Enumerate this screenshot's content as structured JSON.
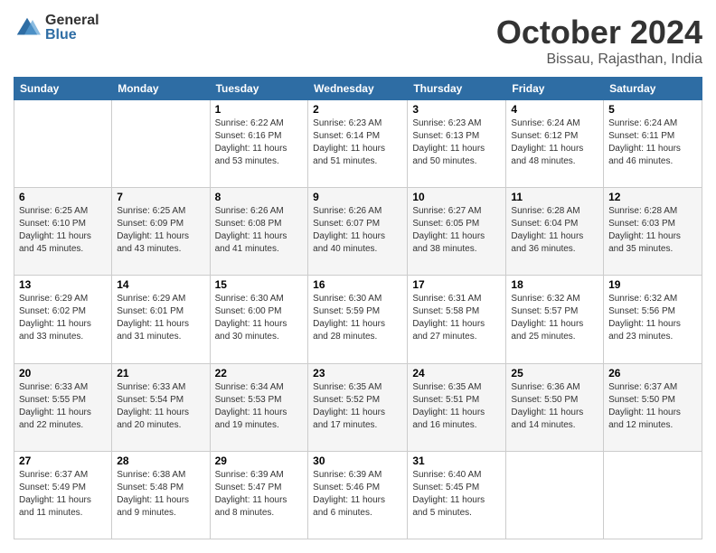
{
  "header": {
    "logo_general": "General",
    "logo_blue": "Blue",
    "title": "October 2024",
    "location": "Bissau, Rajasthan, India"
  },
  "weekdays": [
    "Sunday",
    "Monday",
    "Tuesday",
    "Wednesday",
    "Thursday",
    "Friday",
    "Saturday"
  ],
  "weeks": [
    [
      {
        "day": "",
        "info": ""
      },
      {
        "day": "",
        "info": ""
      },
      {
        "day": "1",
        "info": "Sunrise: 6:22 AM\nSunset: 6:16 PM\nDaylight: 11 hours and 53 minutes."
      },
      {
        "day": "2",
        "info": "Sunrise: 6:23 AM\nSunset: 6:14 PM\nDaylight: 11 hours and 51 minutes."
      },
      {
        "day": "3",
        "info": "Sunrise: 6:23 AM\nSunset: 6:13 PM\nDaylight: 11 hours and 50 minutes."
      },
      {
        "day": "4",
        "info": "Sunrise: 6:24 AM\nSunset: 6:12 PM\nDaylight: 11 hours and 48 minutes."
      },
      {
        "day": "5",
        "info": "Sunrise: 6:24 AM\nSunset: 6:11 PM\nDaylight: 11 hours and 46 minutes."
      }
    ],
    [
      {
        "day": "6",
        "info": "Sunrise: 6:25 AM\nSunset: 6:10 PM\nDaylight: 11 hours and 45 minutes."
      },
      {
        "day": "7",
        "info": "Sunrise: 6:25 AM\nSunset: 6:09 PM\nDaylight: 11 hours and 43 minutes."
      },
      {
        "day": "8",
        "info": "Sunrise: 6:26 AM\nSunset: 6:08 PM\nDaylight: 11 hours and 41 minutes."
      },
      {
        "day": "9",
        "info": "Sunrise: 6:26 AM\nSunset: 6:07 PM\nDaylight: 11 hours and 40 minutes."
      },
      {
        "day": "10",
        "info": "Sunrise: 6:27 AM\nSunset: 6:05 PM\nDaylight: 11 hours and 38 minutes."
      },
      {
        "day": "11",
        "info": "Sunrise: 6:28 AM\nSunset: 6:04 PM\nDaylight: 11 hours and 36 minutes."
      },
      {
        "day": "12",
        "info": "Sunrise: 6:28 AM\nSunset: 6:03 PM\nDaylight: 11 hours and 35 minutes."
      }
    ],
    [
      {
        "day": "13",
        "info": "Sunrise: 6:29 AM\nSunset: 6:02 PM\nDaylight: 11 hours and 33 minutes."
      },
      {
        "day": "14",
        "info": "Sunrise: 6:29 AM\nSunset: 6:01 PM\nDaylight: 11 hours and 31 minutes."
      },
      {
        "day": "15",
        "info": "Sunrise: 6:30 AM\nSunset: 6:00 PM\nDaylight: 11 hours and 30 minutes."
      },
      {
        "day": "16",
        "info": "Sunrise: 6:30 AM\nSunset: 5:59 PM\nDaylight: 11 hours and 28 minutes."
      },
      {
        "day": "17",
        "info": "Sunrise: 6:31 AM\nSunset: 5:58 PM\nDaylight: 11 hours and 27 minutes."
      },
      {
        "day": "18",
        "info": "Sunrise: 6:32 AM\nSunset: 5:57 PM\nDaylight: 11 hours and 25 minutes."
      },
      {
        "day": "19",
        "info": "Sunrise: 6:32 AM\nSunset: 5:56 PM\nDaylight: 11 hours and 23 minutes."
      }
    ],
    [
      {
        "day": "20",
        "info": "Sunrise: 6:33 AM\nSunset: 5:55 PM\nDaylight: 11 hours and 22 minutes."
      },
      {
        "day": "21",
        "info": "Sunrise: 6:33 AM\nSunset: 5:54 PM\nDaylight: 11 hours and 20 minutes."
      },
      {
        "day": "22",
        "info": "Sunrise: 6:34 AM\nSunset: 5:53 PM\nDaylight: 11 hours and 19 minutes."
      },
      {
        "day": "23",
        "info": "Sunrise: 6:35 AM\nSunset: 5:52 PM\nDaylight: 11 hours and 17 minutes."
      },
      {
        "day": "24",
        "info": "Sunrise: 6:35 AM\nSunset: 5:51 PM\nDaylight: 11 hours and 16 minutes."
      },
      {
        "day": "25",
        "info": "Sunrise: 6:36 AM\nSunset: 5:50 PM\nDaylight: 11 hours and 14 minutes."
      },
      {
        "day": "26",
        "info": "Sunrise: 6:37 AM\nSunset: 5:50 PM\nDaylight: 11 hours and 12 minutes."
      }
    ],
    [
      {
        "day": "27",
        "info": "Sunrise: 6:37 AM\nSunset: 5:49 PM\nDaylight: 11 hours and 11 minutes."
      },
      {
        "day": "28",
        "info": "Sunrise: 6:38 AM\nSunset: 5:48 PM\nDaylight: 11 hours and 9 minutes."
      },
      {
        "day": "29",
        "info": "Sunrise: 6:39 AM\nSunset: 5:47 PM\nDaylight: 11 hours and 8 minutes."
      },
      {
        "day": "30",
        "info": "Sunrise: 6:39 AM\nSunset: 5:46 PM\nDaylight: 11 hours and 6 minutes."
      },
      {
        "day": "31",
        "info": "Sunrise: 6:40 AM\nSunset: 5:45 PM\nDaylight: 11 hours and 5 minutes."
      },
      {
        "day": "",
        "info": ""
      },
      {
        "day": "",
        "info": ""
      }
    ]
  ]
}
